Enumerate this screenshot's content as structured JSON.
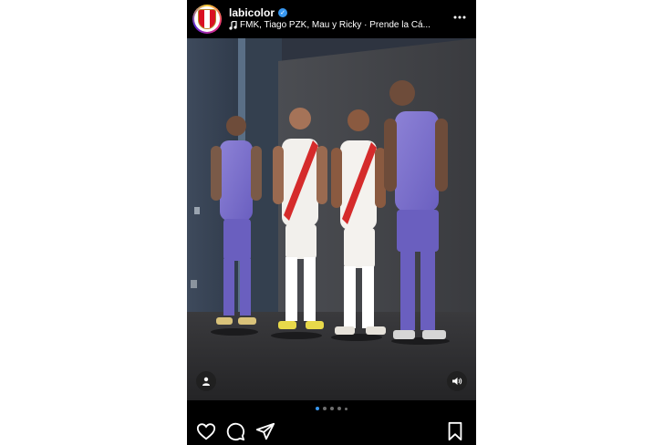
{
  "post": {
    "username": "labicolor",
    "verified": true,
    "audio_text": "FMK, Tiago PZK, Mau y Ricky · Prende la Cá...",
    "carousel": {
      "slides": 5,
      "current": 1
    }
  },
  "icons": {
    "more": "more-horizontal-icon",
    "music": "music-note-icon",
    "tag": "person-tag-icon",
    "sound": "speaker-icon",
    "like": "heart-icon",
    "comment": "comment-icon",
    "share": "send-icon",
    "save": "bookmark-icon"
  },
  "colors": {
    "background": "#000000",
    "verified_badge": "#3897f0",
    "active_dot": "#3897f0"
  }
}
